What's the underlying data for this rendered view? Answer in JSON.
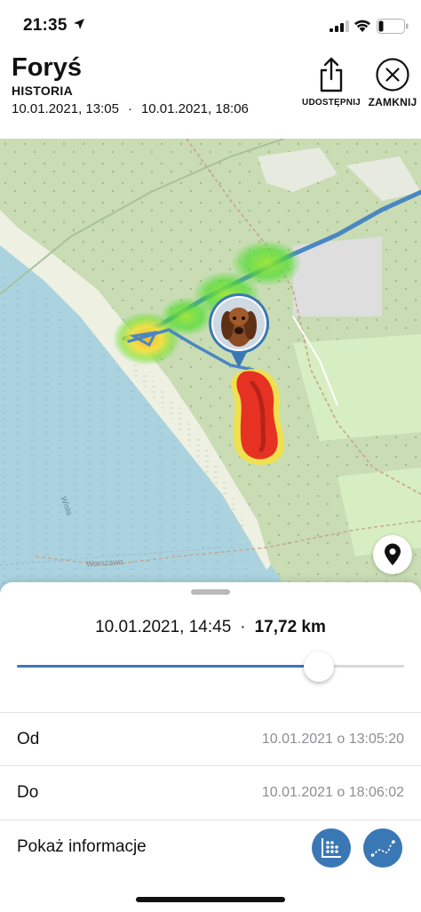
{
  "status_bar": {
    "time": "21:35"
  },
  "header": {
    "title": "Foryś",
    "subtitle": "HISTORIA",
    "range_start": "10.01.2021, 13:05",
    "range_sep": "·",
    "range_end": "10.01.2021, 18:06",
    "share_label": "UDOSTĘPNIJ",
    "close_label": "ZAMKNIJ"
  },
  "map": {
    "labels": [
      "Wisła",
      "Warszawa"
    ],
    "track_color": "#3a78b5",
    "heat_colors": [
      "#e53223",
      "#f5e042",
      "#4fdc2e"
    ]
  },
  "sheet": {
    "timestamp": "10.01.2021, 14:45",
    "sep": "·",
    "distance": "17,72 km",
    "slider_progress": 0.78,
    "rows": [
      {
        "label": "Od",
        "value": "10.01.2021 o 13:05:20"
      },
      {
        "label": "Do",
        "value": "10.01.2021 o 18:06:02"
      },
      {
        "label": "Pokaż informacje"
      }
    ]
  },
  "icons": {
    "share": "share-icon",
    "close": "close-icon",
    "locate": "location-pin-icon",
    "stats": "stats-grid-icon",
    "track": "route-icon"
  }
}
